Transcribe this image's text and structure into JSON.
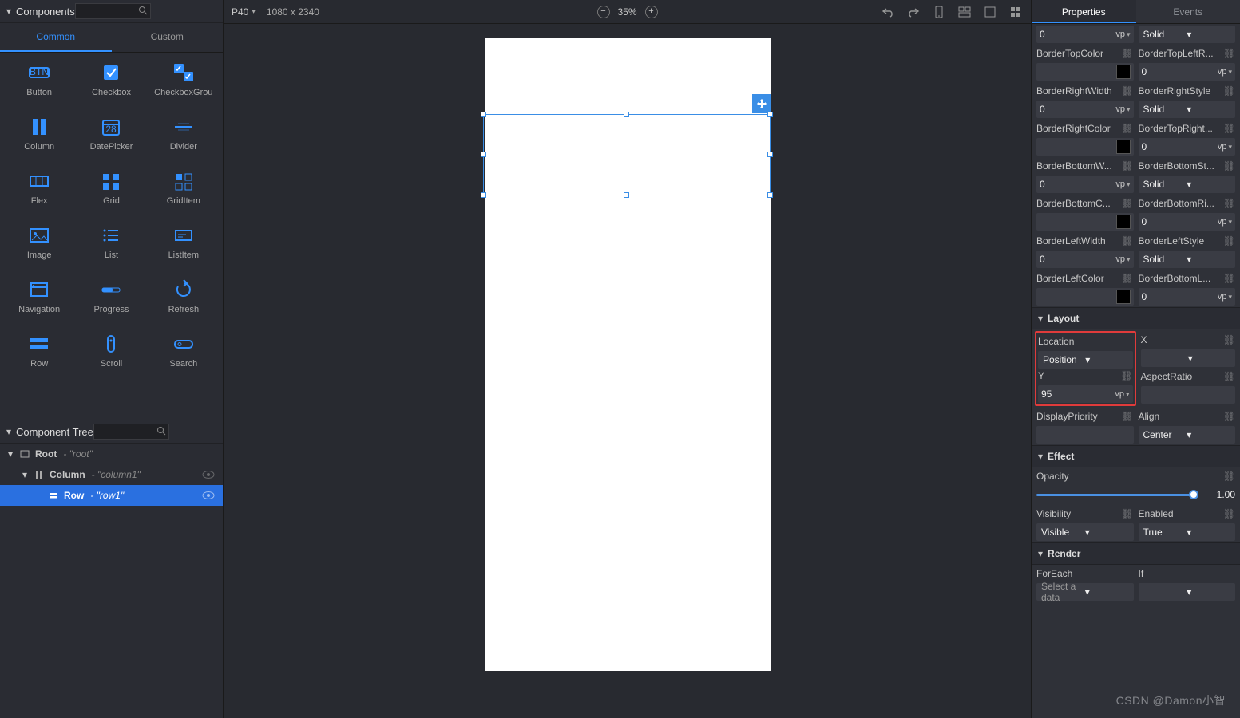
{
  "leftPanel": {
    "title": "Components",
    "tabs": [
      "Common",
      "Custom"
    ],
    "activeTab": 0,
    "items": [
      "Button",
      "Checkbox",
      "CheckboxGrou",
      "Column",
      "DatePicker",
      "Divider",
      "Flex",
      "Grid",
      "GridItem",
      "Image",
      "List",
      "ListItem",
      "Navigation",
      "Progress",
      "Refresh",
      "Row",
      "Scroll",
      "Search"
    ]
  },
  "treePanel": {
    "title": "Component Tree",
    "nodes": [
      {
        "depth": 0,
        "name": "Root",
        "id": "\"root\"",
        "sel": false,
        "eye": false
      },
      {
        "depth": 1,
        "name": "Column",
        "id": "\"column1\"",
        "sel": false,
        "eye": true
      },
      {
        "depth": 2,
        "name": "Row",
        "id": "\"row1\"",
        "sel": true,
        "eye": true
      }
    ]
  },
  "topbar": {
    "device": "P40",
    "resolution": "1080 x 2340",
    "zoom": "35%"
  },
  "rightPanel": {
    "tabs": [
      "Properties",
      "Events"
    ],
    "activeTab": 0
  },
  "props": {
    "truncatedTop": {
      "val": "0",
      "unit": "vp",
      "sel": "Solid"
    },
    "borderTopColor": {
      "label": "BorderTopColor"
    },
    "borderTopLeftR": {
      "label": "BorderTopLeftR...",
      "val": "0",
      "unit": "vp"
    },
    "borderRightWidth": {
      "label": "BorderRightWidth",
      "val": "0",
      "unit": "vp"
    },
    "borderRightStyle": {
      "label": "BorderRightStyle",
      "val": "Solid"
    },
    "borderRightColor": {
      "label": "BorderRightColor"
    },
    "borderTopRight": {
      "label": "BorderTopRight...",
      "val": "0",
      "unit": "vp"
    },
    "borderBottomW": {
      "label": "BorderBottomW...",
      "val": "0",
      "unit": "vp"
    },
    "borderBottomSt": {
      "label": "BorderBottomSt...",
      "val": "Solid"
    },
    "borderBottomC": {
      "label": "BorderBottomC..."
    },
    "borderBottomRi": {
      "label": "BorderBottomRi...",
      "val": "0",
      "unit": "vp"
    },
    "borderLeftWidth": {
      "label": "BorderLeftWidth",
      "val": "0",
      "unit": "vp"
    },
    "borderLeftStyle": {
      "label": "BorderLeftStyle",
      "val": "Solid"
    },
    "borderLeftColor": {
      "label": "BorderLeftColor"
    },
    "borderBottomL": {
      "label": "BorderBottomL...",
      "val": "0",
      "unit": "vp"
    }
  },
  "layout": {
    "section": "Layout",
    "location": {
      "label": "Location",
      "val": "Position"
    },
    "x": {
      "label": "X"
    },
    "y": {
      "label": "Y",
      "val": "95",
      "unit": "vp"
    },
    "aspect": {
      "label": "AspectRatio"
    },
    "display": {
      "label": "DisplayPriority"
    },
    "align": {
      "label": "Align",
      "val": "Center"
    }
  },
  "effect": {
    "section": "Effect",
    "opacity": {
      "label": "Opacity",
      "val": "1.00"
    },
    "visibility": {
      "label": "Visibility",
      "val": "Visible"
    },
    "enabled": {
      "label": "Enabled",
      "val": "True"
    }
  },
  "render": {
    "section": "Render",
    "forEach": {
      "label": "ForEach",
      "val": "Select a data"
    },
    "if": {
      "label": "If"
    }
  },
  "watermark": "CSDN @Damon小智"
}
